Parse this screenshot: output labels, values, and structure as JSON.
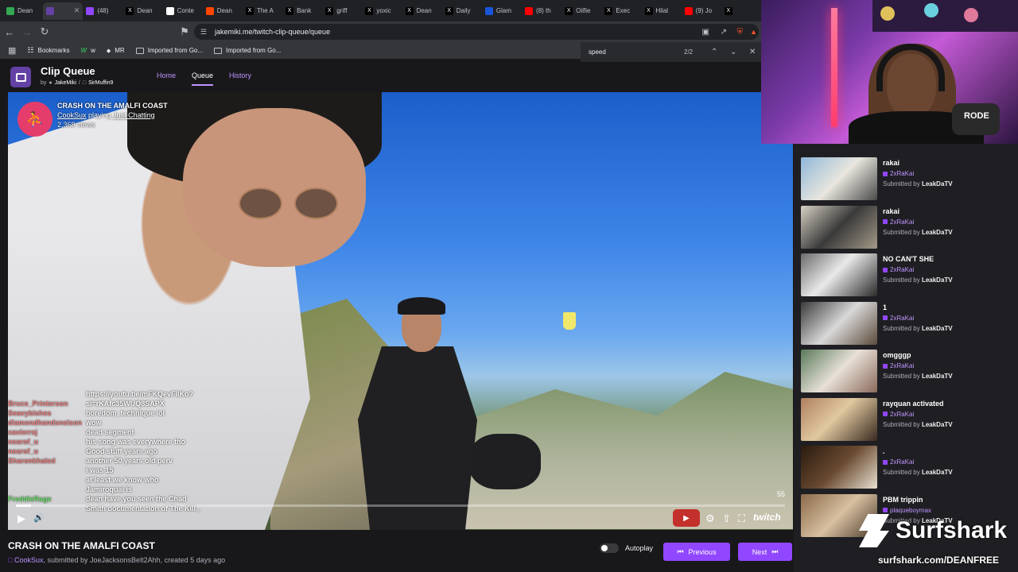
{
  "browser": {
    "tabs": [
      {
        "label": "Dean",
        "icon": "green-leaf-icon",
        "color": "#34a853"
      },
      {
        "label": "",
        "icon": "clip-queue-icon",
        "color": "#6441a5",
        "active": true
      },
      {
        "label": "(48)",
        "icon": "twitch-icon",
        "color": "#9147ff"
      },
      {
        "label": "Dean",
        "icon": "x-icon",
        "color": "#000000"
      },
      {
        "label": "Conte",
        "icon": "youtube-studio-icon",
        "color": "#ffffff"
      },
      {
        "label": "Dean",
        "icon": "reddit-icon",
        "color": "#ff4500"
      },
      {
        "label": "The A",
        "icon": "x-icon",
        "color": "#000000"
      },
      {
        "label": "Bank",
        "icon": "x-icon",
        "color": "#000000"
      },
      {
        "label": "griff",
        "icon": "x-icon",
        "color": "#000000"
      },
      {
        "label": "yoxic",
        "icon": "x-icon",
        "color": "#000000"
      },
      {
        "label": "Dean",
        "icon": "x-icon",
        "color": "#000000"
      },
      {
        "label": "Daily",
        "icon": "x-icon",
        "color": "#000000"
      },
      {
        "label": "Glam",
        "icon": "m-icon",
        "color": "#1a56db"
      },
      {
        "label": "(8) th",
        "icon": "youtube-icon",
        "color": "#ff0000"
      },
      {
        "label": "Oilfie",
        "icon": "x-icon",
        "color": "#000000"
      },
      {
        "label": "Exec",
        "icon": "x-icon",
        "color": "#000000"
      },
      {
        "label": "Hilal",
        "icon": "x-icon",
        "color": "#000000"
      },
      {
        "label": "(9) Jo",
        "icon": "youtube-icon",
        "color": "#ff0000"
      },
      {
        "label": "",
        "icon": "x-icon",
        "color": "#000000"
      }
    ],
    "url": "jakemiki.me/twitch-clip-queue/queue",
    "bookmarks": [
      {
        "label": "Bookmarks",
        "icon": "bookmarks-icon"
      },
      {
        "label": "w",
        "icon": "w-icon"
      },
      {
        "label": "MR",
        "icon": "mr-icon"
      },
      {
        "label": "Imported from Go...",
        "icon": "folder-icon"
      },
      {
        "label": "Imported from Go...",
        "icon": "folder-icon"
      }
    ],
    "find": {
      "query": "speed",
      "count": "2/2"
    }
  },
  "app": {
    "title": "Clip Queue",
    "by": "by",
    "author": "JakeMiki",
    "channel": "SirMuffin9",
    "nav": [
      {
        "label": "Home"
      },
      {
        "label": "Queue",
        "current": true
      },
      {
        "label": "History"
      }
    ]
  },
  "clip": {
    "title": "CRASH ON THE AMALFI COAST",
    "channel": "CookSux",
    "playing": "playing",
    "category": "Just Chatting",
    "views": "2,368 views",
    "progress_fraction": 0.02,
    "seconds": "55",
    "twitch_word": "twitch",
    "bottom_title": "CRASH ON THE AMALFI COAST",
    "bottom_channel": "CookSux",
    "submitted_by_label": ", submitted by",
    "submitter": "JoeJacksonsBelt2Ahh",
    "created": ", created 5 days ago"
  },
  "chat": [
    {
      "user": "",
      "msg": "https://youtu.be/mFKQevFlIKo?"
    },
    {
      "user": "Bruce_Printerson",
      "msg": "si=rKAfc35WUQ8SAPX"
    },
    {
      "user": "Seavybishes",
      "msg": "boredom_technique lol"
    },
    {
      "user": "diamondhandsnelson",
      "msg": "wow"
    },
    {
      "user": "xavierrsj",
      "msg": "dead segment"
    },
    {
      "user": "nearof_u",
      "msg": "his song was everywhere tho"
    },
    {
      "user": "nearof_u",
      "msg": "Good stuff years ago"
    },
    {
      "user": "Sharonkhaled",
      "msg": "another 50 years old perv"
    },
    {
      "user": "",
      "msg": "i was 15"
    },
    {
      "user": "",
      "msg": "at least we know who"
    },
    {
      "user": "",
      "msg": "Jamiroquai is"
    },
    {
      "user": "FreddieRage",
      "msg": "dean have you seen the Chad"
    },
    {
      "user": "",
      "msg": "Smith documentation of The Kill ,"
    }
  ],
  "controls": {
    "autoplay_label": "Autoplay",
    "previous_label": "Previous",
    "next_label": "Next"
  },
  "queue": [
    {
      "title": "rakai",
      "channel": "2xRaKai",
      "submitted": "Submitted by",
      "by": "LeakDaTV"
    },
    {
      "title": "rakai",
      "channel": "2xRaKai",
      "submitted": "Submitted by",
      "by": "LeakDaTV"
    },
    {
      "title": "NO CAN'T SHE",
      "channel": "2xRaKai",
      "submitted": "Submitted by",
      "by": "LeakDaTV"
    },
    {
      "title": "1",
      "channel": "2xRaKai",
      "submitted": "Submitted by",
      "by": "LeakDaTV"
    },
    {
      "title": "omgggp",
      "channel": "2xRaKai",
      "submitted": "Submitted by",
      "by": "LeakDaTV"
    },
    {
      "title": "rayquan activated",
      "channel": "2xRaKai",
      "submitted": "Submitted by",
      "by": "LeakDaTV"
    },
    {
      "title": ".",
      "channel": "2xRaKai",
      "submitted": "Submitted by",
      "by": "LeakDaTV"
    },
    {
      "title": "PBM trippin",
      "channel": "plaqueboymax",
      "submitted": "Submitted by",
      "by": "LeakDaTV"
    }
  ],
  "sponsor": {
    "name": "Surfshark",
    "url": "surfshark.com/DEANFREE"
  },
  "webcam": {
    "mic_text": "RODE"
  }
}
